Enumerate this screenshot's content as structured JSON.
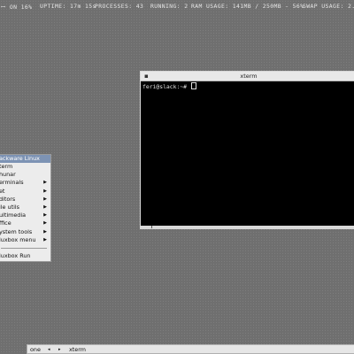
{
  "statusbar": {
    "cpu": "ꟷ ON 16%",
    "uptime": "UPTIME: 17m 15s",
    "processes": "PROCESSES: 43",
    "running": "RUNNING: 2",
    "ram": "RAM USAGE: 141MB / 250MB - 56%",
    "swap": "SWAP USAGE: 2.6"
  },
  "xterm": {
    "title": "xterm",
    "prompt": "feri@slack:~# "
  },
  "rootmenu": {
    "title": "ackware Linux",
    "items": [
      {
        "label": "term",
        "submenu": false
      },
      {
        "label": "hunar",
        "submenu": false
      },
      {
        "label": "erminals",
        "submenu": true
      },
      {
        "label": "et",
        "submenu": true
      },
      {
        "label": "ditors",
        "submenu": true
      },
      {
        "label": "ile utils",
        "submenu": true
      },
      {
        "label": "ultimedia",
        "submenu": true
      },
      {
        "label": "ffice",
        "submenu": true
      },
      {
        "label": "ystem tools",
        "submenu": true
      },
      {
        "label": "luxbox menu",
        "submenu": true
      }
    ],
    "run": "luxbox Run"
  },
  "toolbar": {
    "workspace": "one",
    "prev": "◂",
    "next": "▸",
    "task": "xterm"
  }
}
